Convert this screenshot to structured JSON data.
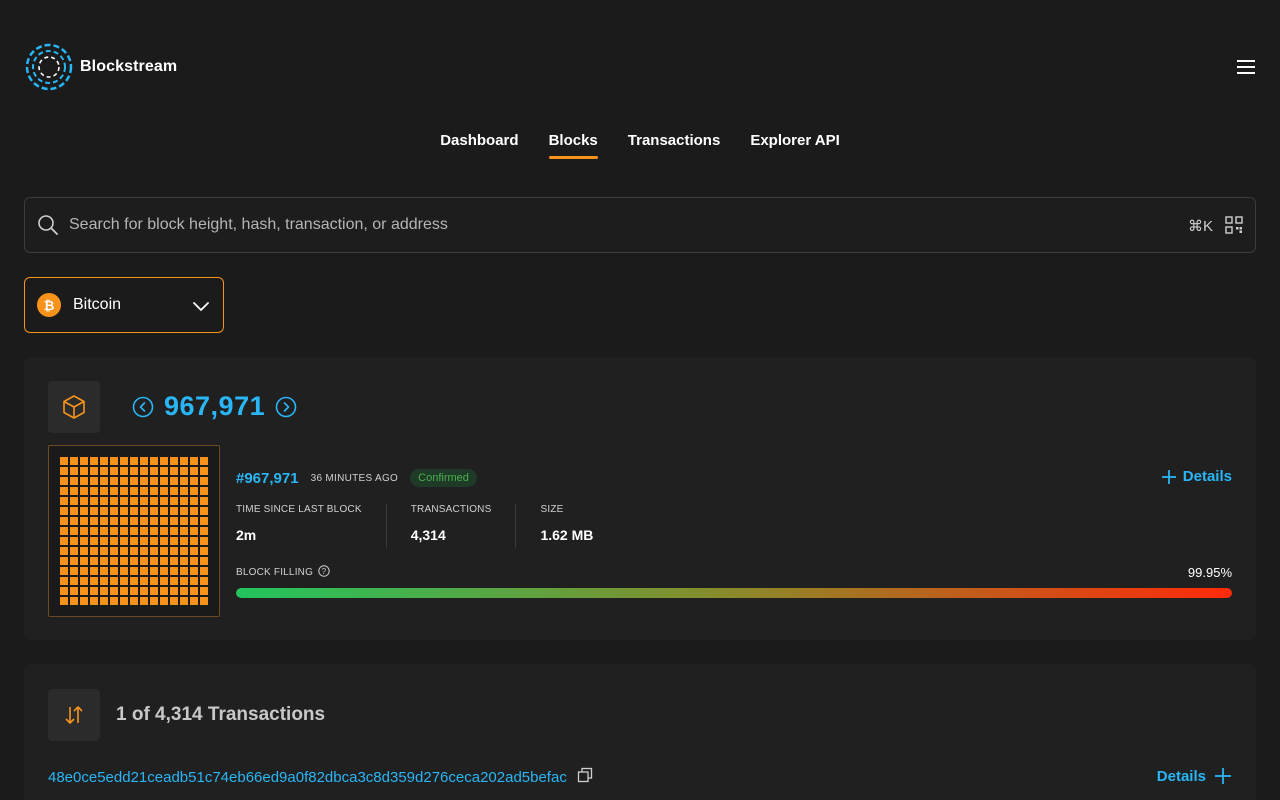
{
  "header": {
    "brand": "Blockstream",
    "logo_icon": "blockstream-logo-icon",
    "menu_icon": "hamburger-menu-icon"
  },
  "nav": {
    "items": [
      {
        "label": "Dashboard",
        "active": false
      },
      {
        "label": "Blocks",
        "active": true
      },
      {
        "label": "Transactions",
        "active": false
      },
      {
        "label": "Explorer API",
        "active": false
      }
    ]
  },
  "search": {
    "placeholder": "Search for block height, hash, transaction, or address",
    "value": "",
    "shortcut": "⌘K",
    "icons": [
      "search-icon",
      "qr-code-icon"
    ]
  },
  "network": {
    "selected": "Bitcoin",
    "coin_symbol": "₿",
    "icon": "bitcoin-icon"
  },
  "block": {
    "height": "967,971",
    "link": "#967,971",
    "time_ago": "36 MINUTES AGO",
    "status": "Confirmed",
    "details_label": "Details",
    "stats": [
      {
        "label": "TIME SINCE LAST BLOCK",
        "value": "2m"
      },
      {
        "label": "TRANSACTIONS",
        "value": "4,314"
      },
      {
        "label": "SIZE",
        "value": "1.62 MB"
      }
    ],
    "filling_label": "BLOCK FILLING",
    "filling_pct": "99.95%",
    "filling_value": 0.9995
  },
  "transactions": {
    "count_label": "1 of 4,314 Transactions",
    "txid": "48e0ce5edd21ceadb51c74eb66ed9a0f82dbca3c8d359d276ceca202ad5befac",
    "details_label": "Details"
  },
  "colors": {
    "accent": "#29b6f6",
    "bitcoin": "#f7931a",
    "confirmed": "#4caf50",
    "background": "#1b1b1b"
  }
}
